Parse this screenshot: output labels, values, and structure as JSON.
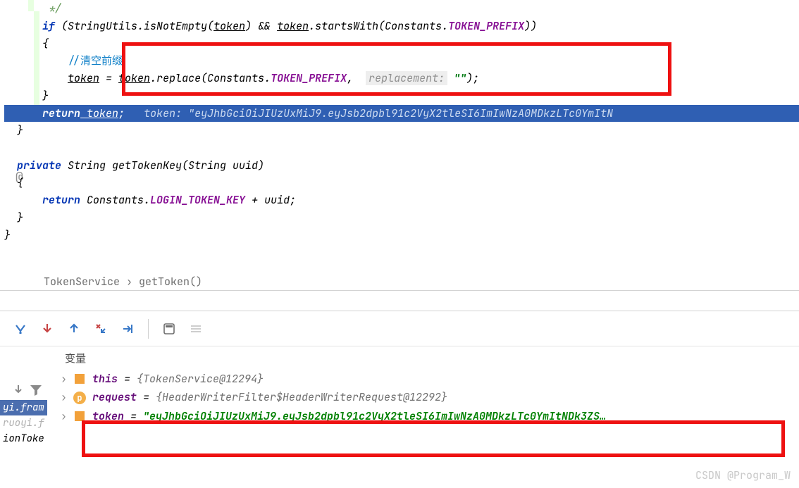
{
  "code": {
    "comment_end": "*/",
    "if_kw": "if",
    "if_cond_a": " (StringUtils.",
    "isNotEmpty": "isNotEmpty",
    "if_cond_b": "(",
    "tokenU": "token",
    "if_cond_c": ") && ",
    "if_cond_d": ".startsWith(Constants.",
    "token_prefix": "TOKEN_PREFIX",
    "if_cond_e": "))",
    "brace_open": "{",
    "clear_prefix_cmt": "//清空前缀",
    "assign_a": "token",
    "assign_b": " = ",
    "assign_c": "token",
    "assign_d": ".replace(Constants.",
    "assign_e": ", ",
    "replacement_hint": "replacement:",
    "empty_str": "\"\"",
    "assign_end": ");",
    "brace_close": "}",
    "return_kw": "return",
    "return_token": " token",
    "semicolon": ";",
    "token_hint_label": "token:",
    "token_hint_value": " \"eyJhbGciOiJIUzUxMiJ9.eyJsb2dpbl91c2VyX2tleSI6ImIwNzA0MDkzLTc0YmItN",
    "brace_close2": "}",
    "private_kw": "private",
    "getTokenKey_a": " String getTokenKey(String uuid)",
    "gtk_return": "return",
    "gtk_body": " Constants.",
    "login_token_key": "LOGIN_TOKEN_KEY",
    "gtk_end": " + uuid;"
  },
  "breadcrumb": {
    "a": "TokenService",
    "sep": " › ",
    "b": "getToken()"
  },
  "vars": {
    "tab": "变量",
    "row1": {
      "name": "this",
      "eq": " = ",
      "val": "{TokenService@12294}"
    },
    "row2": {
      "name": "request",
      "eq": " = ",
      "val": "{HeaderWriterFilter$HeaderWriterRequest@12292}"
    },
    "row3": {
      "name": "token",
      "eq": " = ",
      "val": "\"eyJhbGciOiJIUzUxMiJ9.eyJsb2dpbl91c2VyX2tleSI6ImIwNzA0MDkzLTc0YmItNDk3ZS…"
    }
  },
  "frames": {
    "f1": "yi.fram",
    "f2": "ruoyi.f",
    "f3": "ionToke"
  },
  "watermark": "CSDN @Program_W"
}
